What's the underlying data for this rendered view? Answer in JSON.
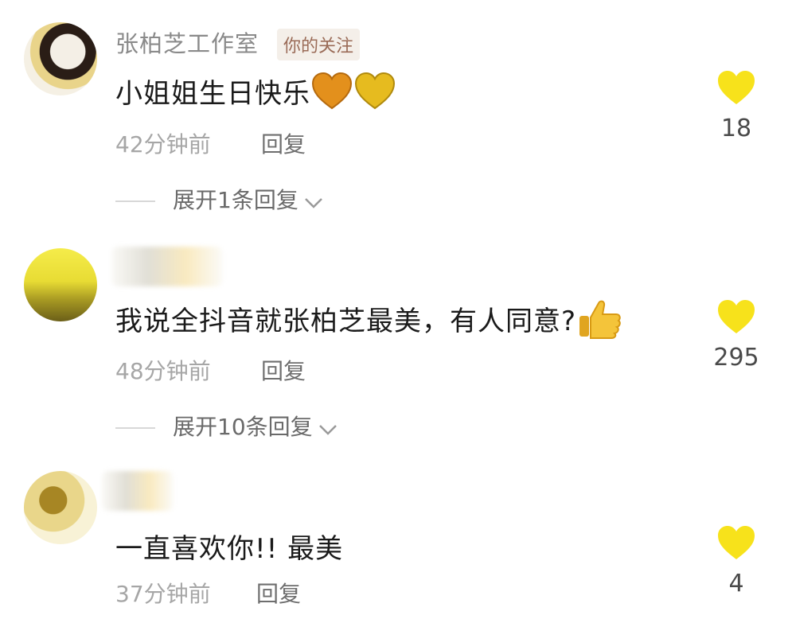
{
  "comments": [
    {
      "username": "张柏芝工作室",
      "tag": "你的关注",
      "text": "小姐姐生日快乐",
      "time": "42分钟前",
      "reply_label": "回复",
      "expand_label": "展开1条回复",
      "likes": "18"
    },
    {
      "username": "",
      "text": "我说全抖音就张柏芝最美，有人同意?",
      "time": "48分钟前",
      "reply_label": "回复",
      "expand_label": "展开10条回复",
      "likes": "295"
    },
    {
      "username": "",
      "text": "一直喜欢你!! 最美",
      "time": "37分钟前",
      "reply_label": "回复",
      "likes": "4"
    }
  ],
  "icons": {
    "like": "yellow-heart-icon",
    "expand": "chevron-down-icon",
    "heart_emoji": "orange-heart-emoji",
    "yellow_heart_emoji": "yellow-heart-emoji",
    "thumb": "thumbs-up-emoji"
  },
  "colors": {
    "like_heart": "#f7e21b",
    "tag_bg": "#f4efe9",
    "meta": "#a6a6a6"
  }
}
